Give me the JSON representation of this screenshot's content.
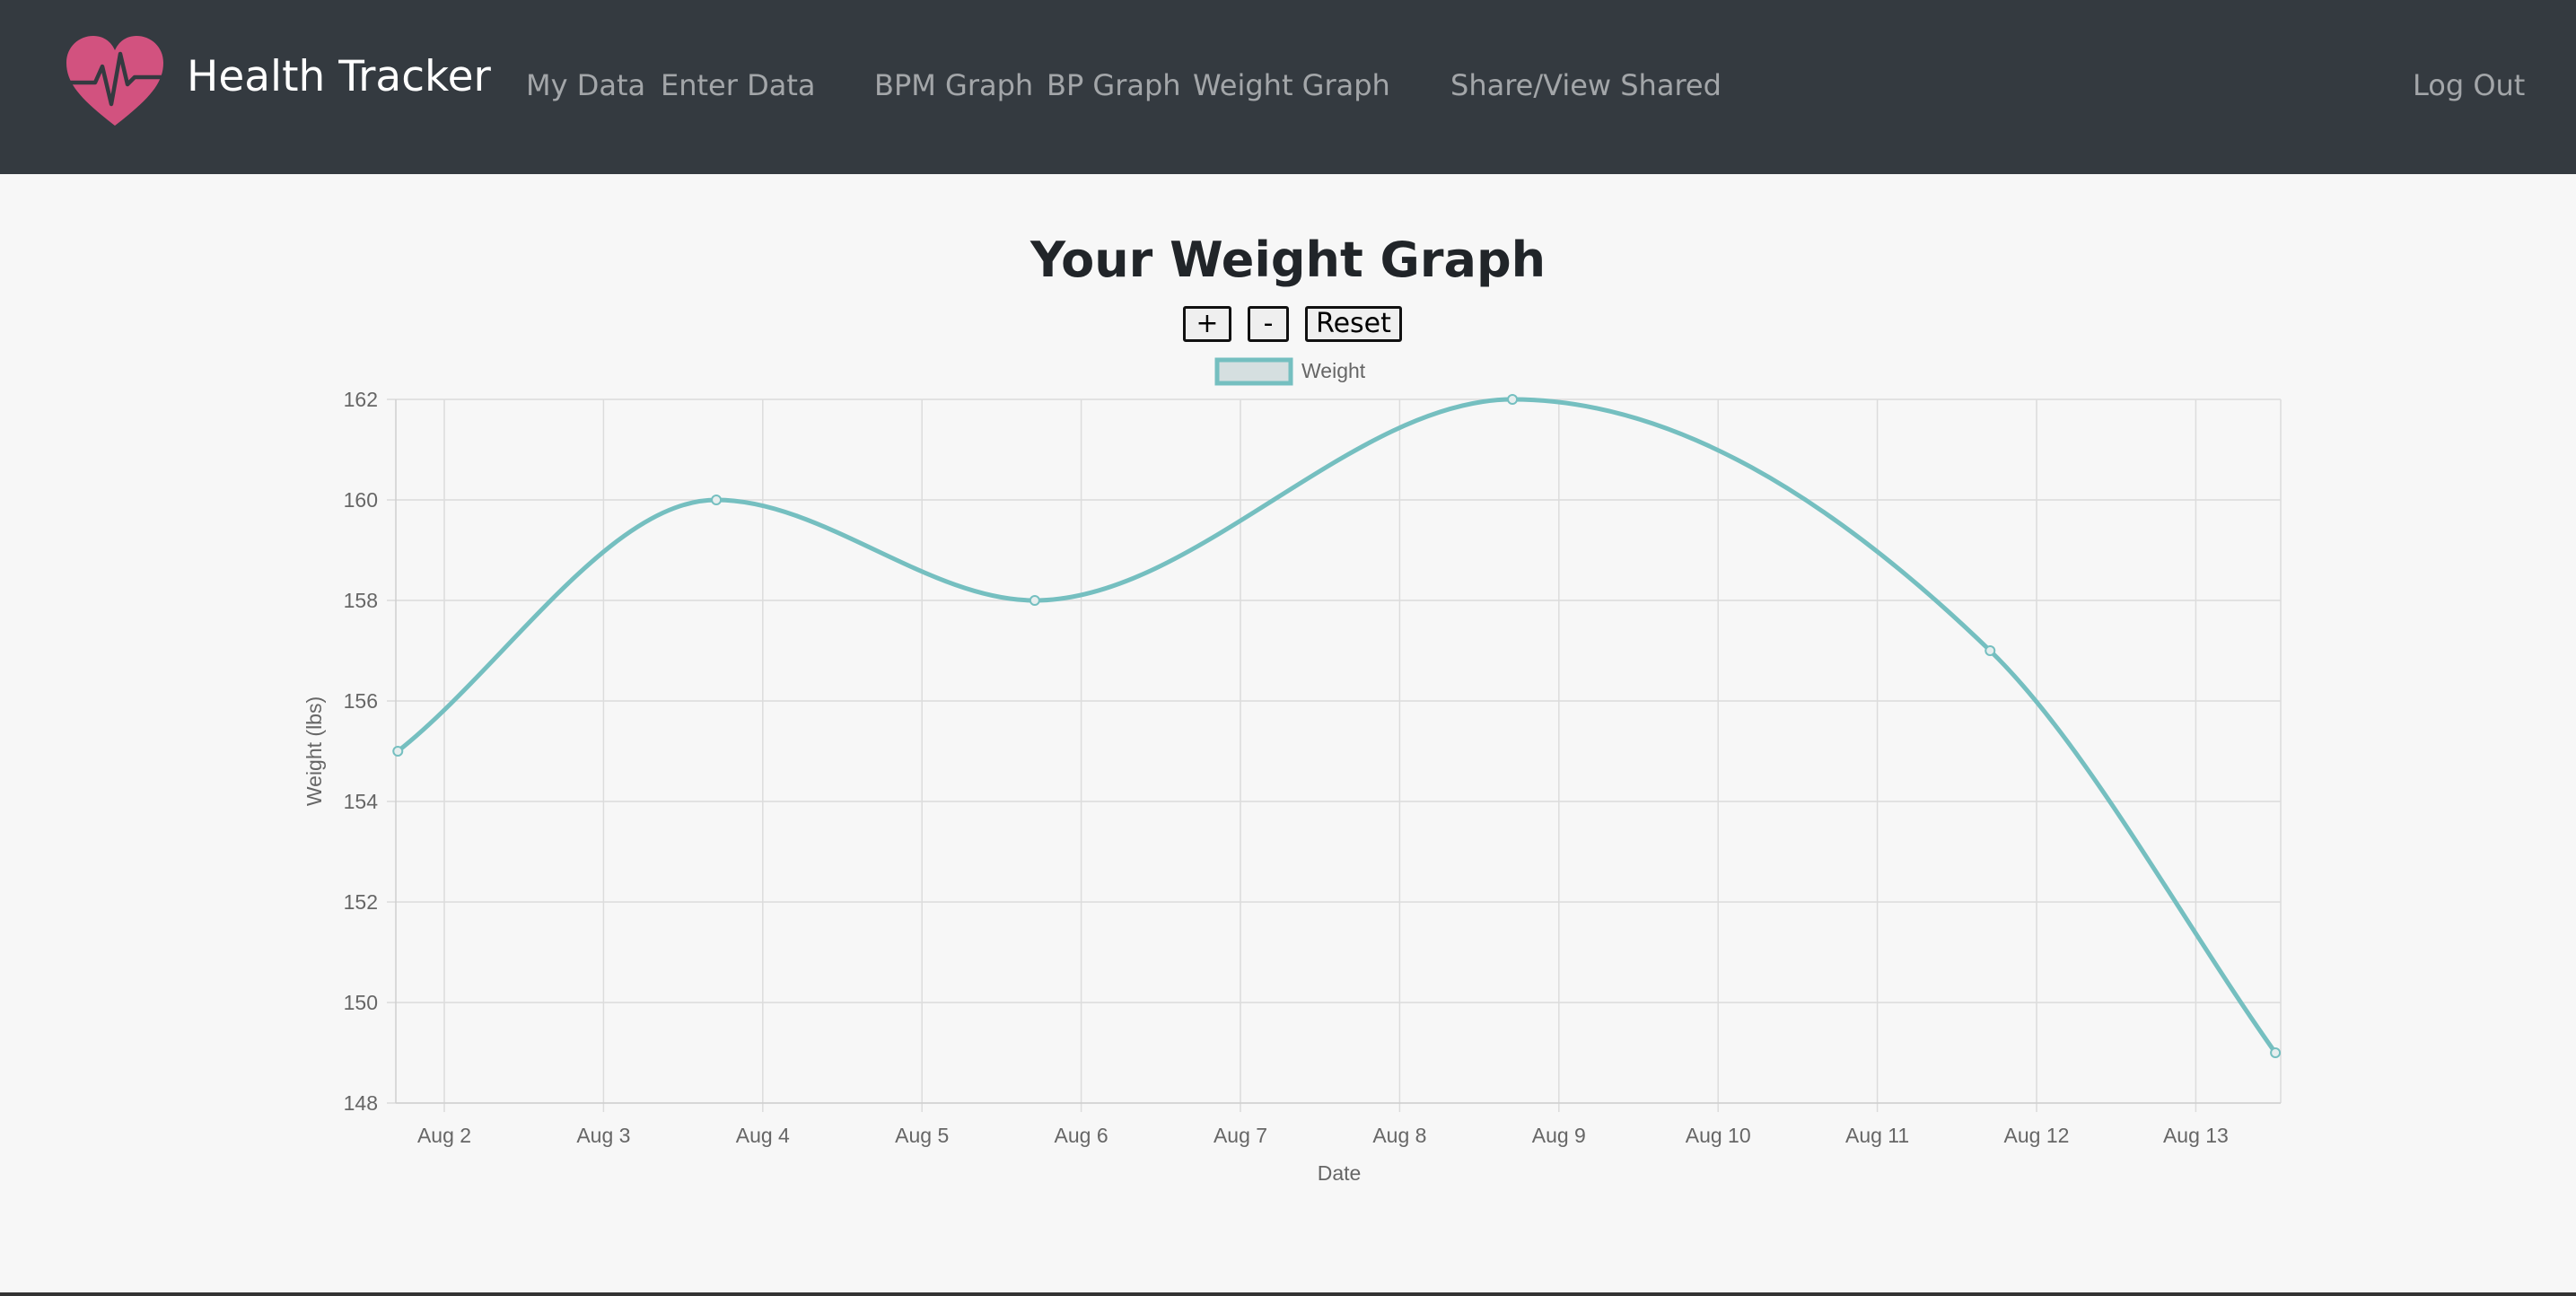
{
  "navbar": {
    "brand": "Health Tracker",
    "links": {
      "my_data": "My Data",
      "enter_data": "Enter Data",
      "bpm_graph": "BPM Graph",
      "bp_graph": "BP Graph",
      "weight_graph": "Weight Graph",
      "share": "Share/View Shared",
      "logout": "Log Out"
    },
    "logo_icon": "heart-pulse-icon",
    "logo_color": "#d2527f"
  },
  "page": {
    "title": "Your Weight Graph",
    "zoom_in_label": "+",
    "zoom_out_label": "-",
    "reset_label": "Reset"
  },
  "chart_data": {
    "type": "line",
    "title": "",
    "xlabel": "Date",
    "ylabel": "Weight (lbs)",
    "legend": {
      "label": "Weight",
      "placement": "top-center"
    },
    "x_ticks": [
      "Aug 2",
      "Aug 3",
      "Aug 4",
      "Aug 5",
      "Aug 6",
      "Aug 7",
      "Aug 8",
      "Aug 9",
      "Aug 10",
      "Aug 11",
      "Aug 12",
      "Aug 13"
    ],
    "y_ticks": [
      148,
      150,
      152,
      154,
      156,
      158,
      160,
      162
    ],
    "ylim": [
      148,
      162
    ],
    "xlim": [
      "Aug 1 17:00",
      "Aug 13 12:00"
    ],
    "grid": true,
    "color": "#75bfc0",
    "series": [
      {
        "name": "Weight",
        "points": [
          {
            "x": "Aug 1 17:00",
            "y": 155
          },
          {
            "x": "Aug 3 17:00",
            "y": 160
          },
          {
            "x": "Aug 5 17:00",
            "y": 158
          },
          {
            "x": "Aug 8 17:00",
            "y": 162
          },
          {
            "x": "Aug 11 17:00",
            "y": 157
          },
          {
            "x": "Aug 13 12:00",
            "y": 149
          }
        ]
      }
    ]
  }
}
